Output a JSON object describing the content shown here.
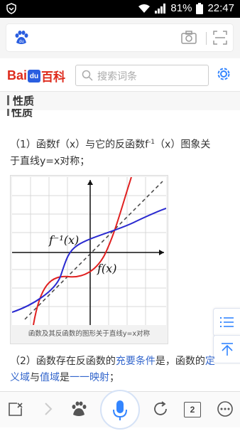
{
  "status": {
    "battery_percent": "81%",
    "time": "22:47"
  },
  "header": {
    "logo_bai": "Bai",
    "logo_du": "du",
    "logo_baike": "百科",
    "search_placeholder": "搜索词条"
  },
  "section": {
    "title": "性质",
    "cut_title": "性质"
  },
  "content": {
    "p1_line1_a": "（1）函数f（x）与它的反函数f",
    "p1_sup": "-1",
    "p1_line1_b": "（x）图象关",
    "p1_line2": "于直线y=x对称；",
    "figure_caption": "函数及其反函数的图形关于直线y=x对称",
    "figure_label_inverse": "f⁻¹(x)",
    "figure_label_f": "f(x)",
    "p2_a": "（2）函数存在反函数的",
    "p2_link1": "充要条件",
    "p2_b": "是，函数的",
    "p2_link2": "定",
    "p2_link2b": "义域",
    "p2_c": "与",
    "p2_link3": "值域",
    "p2_d": "是",
    "p2_link4": "一一映射",
    "p2_e": "；"
  },
  "bottom": {
    "tab_count": "2"
  },
  "colors": {
    "accent": "#3366cc",
    "red_curve": "#e02020",
    "blue_curve": "#2a2ad0",
    "logo_red": "#de2b1d"
  }
}
